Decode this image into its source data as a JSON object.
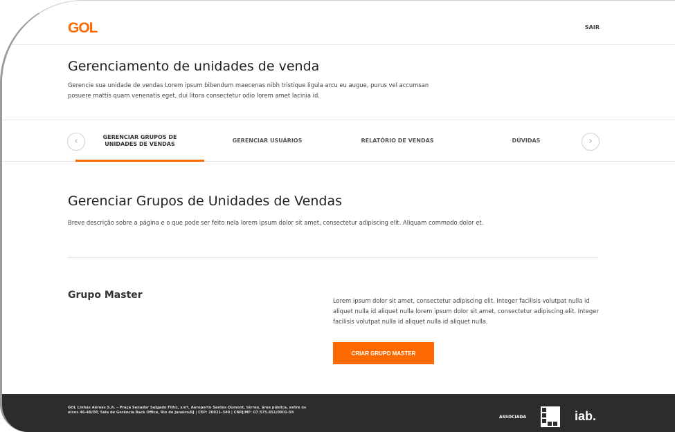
{
  "header": {
    "logo": "GOL",
    "logout_label": "SAIR"
  },
  "page": {
    "title": "Gerenciamento de unidades de venda",
    "description": "Gerencie sua unidade de vendas Lorem ipsum bibendum maecenas nibh tristique ligula arcu eu augue, purus vel accumsan posuere mattis quam venenatis eget, dui litora consectetur odio lorem amet lacinia id."
  },
  "tabs": {
    "prev_icon": "chevron-left-icon",
    "next_icon": "chevron-right-icon",
    "items": [
      {
        "label": "GERENCIAR GRUPOS DE UNIDADES DE VENDAS",
        "active": true
      },
      {
        "label": "GERENCIAR USUÁRIOS",
        "active": false
      },
      {
        "label": "RELATÓRIO DE VENDAS",
        "active": false
      },
      {
        "label": "DÚVIDAS",
        "active": false
      }
    ]
  },
  "section": {
    "title": "Gerenciar Grupos de Unidades de Vendas",
    "description": "Breve descrição sobre a página e o que pode ser feito nela lorem ipsum dolor sit amet, consectetur adipiscing elit. Aliquam commodo dolor et."
  },
  "group": {
    "name": "Grupo Master",
    "description": "Lorem ipsum dolor sit amet, consectetur adipiscing elit. Integer facilisis volutpat nulla id aliquet nulla id aliquet nulla lorem ipsum dolor sit amet, consectetur adipiscing elit. Integer facilisis volutpat nulla id aliquet nulla id aliquet nulla.",
    "button_label": "CRIAR GRUPO MASTER"
  },
  "footer": {
    "company_text": "GOL Linhas Aéreas S.A. – Praça Senador Salgado Filho, s/nº, Aeroporto Santos Dumont, térreo, área pública, entre os eixos 46-48/OP, Sala de Gerência Back Office, Rio de Janeiro/RJ | CEP: 20021-340 | CNPJ/MF: 07.575.651/0001-59",
    "associada_label": "ASSOCIADA",
    "abear_logo": "abear-logo",
    "iab_label": "iab."
  },
  "colors": {
    "brand_orange": "#ff6a00",
    "footer_bg": "#2c2c2c"
  }
}
